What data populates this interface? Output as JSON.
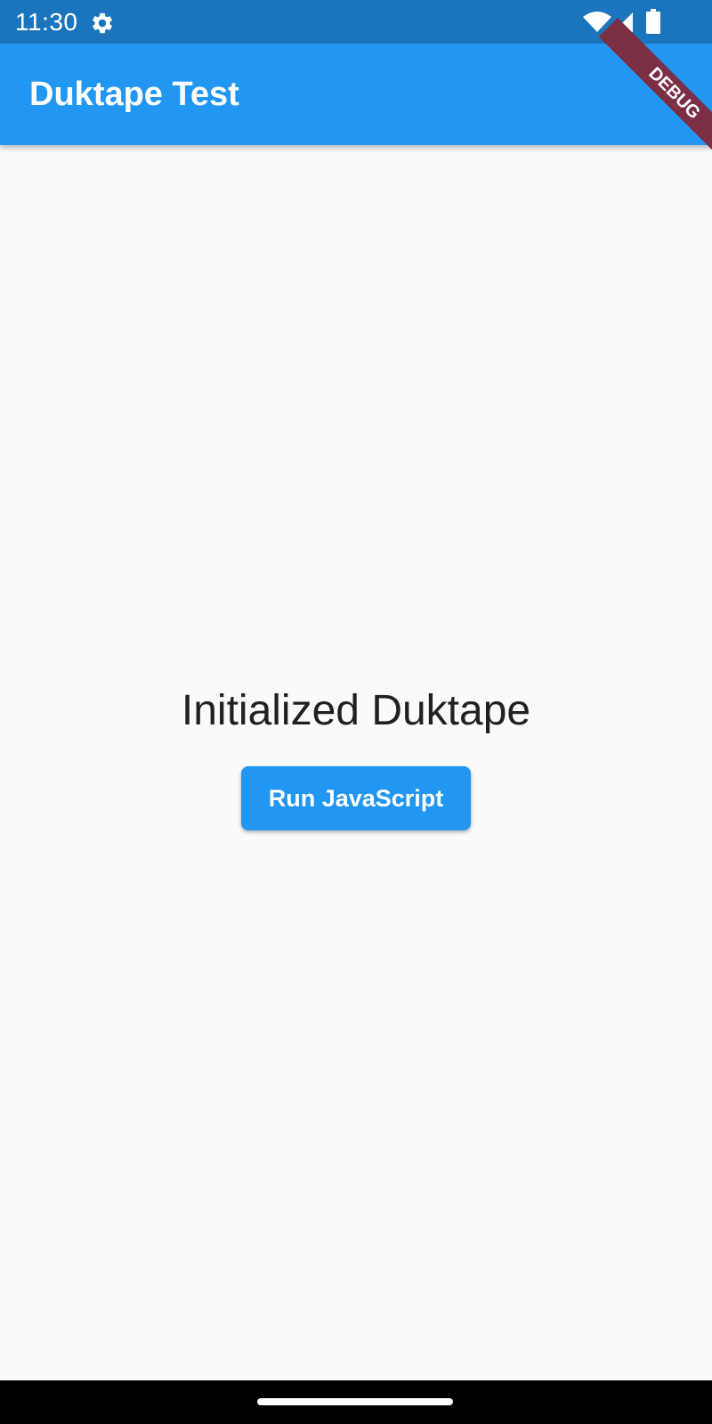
{
  "status_bar": {
    "time": "11:30",
    "icons": [
      "gear-icon",
      "wifi-icon",
      "signal-icon",
      "battery-icon"
    ],
    "background": "#1B75BC"
  },
  "app_bar": {
    "title": "Duktape Test",
    "background": "#2196F3"
  },
  "debug_banner": {
    "label": "DEBUG",
    "color": "#7B2E44"
  },
  "main": {
    "status_text": "Initialized Duktape",
    "run_button_label": "Run JavaScript"
  },
  "colors": {
    "accent": "#2196F3",
    "page_background": "#FAFAFA",
    "text": "#212121"
  }
}
